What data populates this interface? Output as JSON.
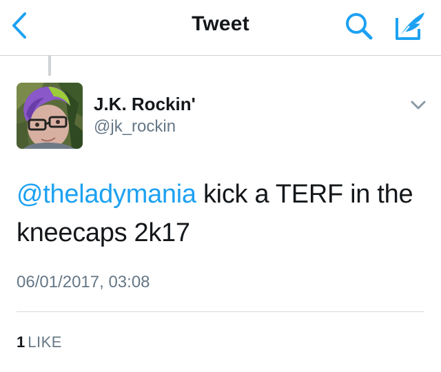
{
  "nav": {
    "title": "Tweet",
    "back_icon": "chevron-left-icon",
    "search_icon": "search-icon",
    "compose_icon": "compose-quill-icon"
  },
  "tweet": {
    "author": {
      "display_name": "J.K. Rockin'",
      "username": "@jk_rockin"
    },
    "mention": "@theladymania",
    "text": " kick a TERF in the kneecaps 2k17",
    "timestamp": "06/01/2017, 03:08",
    "stats": {
      "likes_count": "1",
      "likes_label": "LIKE"
    }
  },
  "colors": {
    "accent": "#1da1f2",
    "secondary_text": "#657786",
    "primary_text": "#14171a",
    "divider": "#d6dbdf"
  }
}
